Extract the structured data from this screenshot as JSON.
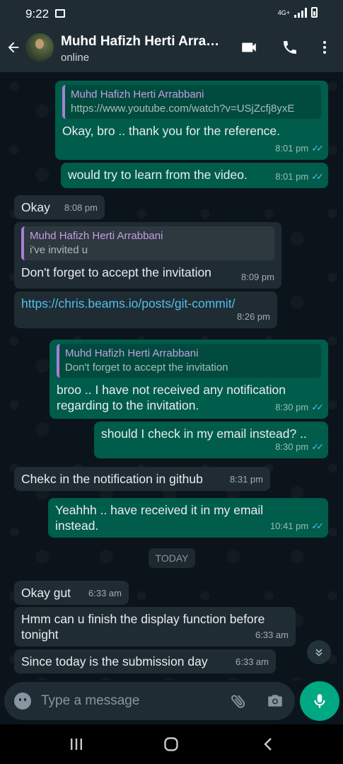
{
  "status_bar": {
    "time": "9:22",
    "network": "4G+"
  },
  "header": {
    "contact_name": "Muhd Hafizh Herti Arrabbani",
    "status": "online"
  },
  "messages": [
    {
      "direction": "out",
      "quote_name": "Muhd Hafizh Herti Arrabbani",
      "quote_text": "https://www.youtube.com/watch?v=USjZcfj8yxE",
      "text": "Okay, bro  .. thank you for the reference.",
      "time": "8:01 pm",
      "read": true
    },
    {
      "direction": "out",
      "text": "would try to learn from the video.",
      "time": "8:01 pm",
      "read": true
    },
    {
      "direction": "in",
      "text": "Okay",
      "time": "8:08 pm"
    },
    {
      "direction": "in",
      "quote_name": "Muhd Hafizh Herti Arrabbani",
      "quote_text": "i've invited u",
      "text": "Don't forget to accept the invitation",
      "time": "8:09 pm"
    },
    {
      "direction": "in",
      "text": "https://chris.beams.io/posts/git-commit/",
      "time": "8:26 pm",
      "is_link": true
    },
    {
      "direction": "out",
      "quote_name": "Muhd Hafizh Herti Arrabbani",
      "quote_text": "Don't forget to accept the invitation",
      "text_line1": "broo .. I have not received any notification",
      "text_line2": "regarding to the invitation.",
      "time": "8:30 pm",
      "read": true
    },
    {
      "direction": "out",
      "text": "should I check in my email instead? ..",
      "time": "8:30 pm",
      "read": true
    },
    {
      "direction": "in",
      "text": "Chekc in the notification in github",
      "time": "8:31 pm"
    },
    {
      "direction": "out",
      "text_line1": "Yeahhh .. have received it in my email",
      "text_line2": "instead.",
      "time": "10:41 pm",
      "read": true
    },
    {
      "direction": "in",
      "text": "Okay gut",
      "time": "6:33 am"
    },
    {
      "direction": "in",
      "text_line1": "Hmm can u finish the display function before",
      "text_line2": "tonight",
      "time": "6:33 am"
    },
    {
      "direction": "in",
      "text": "Since today is the submission day",
      "time": "6:33 am"
    }
  ],
  "date_divider": "TODAY",
  "composer": {
    "placeholder": "Type a message"
  },
  "colors": {
    "header": "#1f2c33",
    "background": "#0b141a",
    "outgoing": "#005c4b",
    "incoming": "#202c33",
    "accent": "#00a884",
    "read_ticks": "#53bdeb",
    "quote_name": "#c79de6"
  },
  "icons": [
    "back-arrow-icon",
    "video-call-icon",
    "voice-call-icon",
    "more-options-icon",
    "emoji-icon",
    "attach-icon",
    "camera-icon",
    "mic-icon",
    "scroll-down-icon",
    "recents-icon",
    "home-icon",
    "nav-back-icon"
  ]
}
